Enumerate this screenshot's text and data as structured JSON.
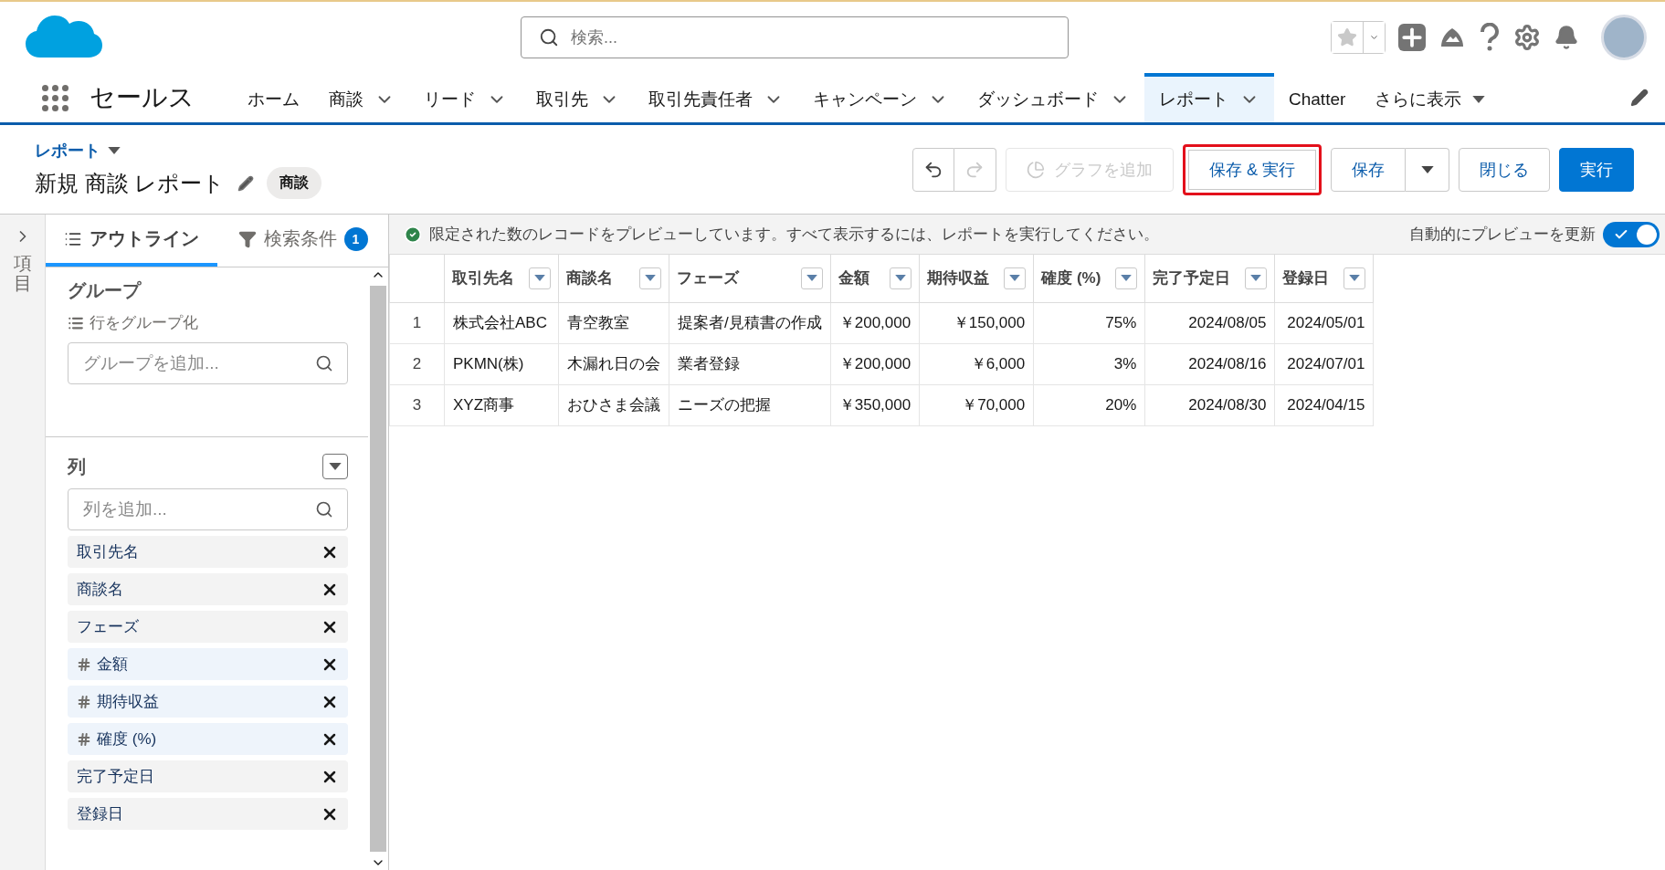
{
  "header": {
    "search_placeholder": "検索...",
    "favorite": false
  },
  "nav": {
    "app_name": "セールス",
    "items": [
      {
        "label": "ホーム",
        "kind": "plain",
        "selected": false
      },
      {
        "label": "商談",
        "kind": "menu",
        "selected": false
      },
      {
        "label": "リード",
        "kind": "menu",
        "selected": false
      },
      {
        "label": "取引先",
        "kind": "menu",
        "selected": false
      },
      {
        "label": "取引先責任者",
        "kind": "menu",
        "selected": false
      },
      {
        "label": "キャンペーン",
        "kind": "menu",
        "selected": false
      },
      {
        "label": "ダッシュボード",
        "kind": "menu",
        "selected": false
      },
      {
        "label": "レポート",
        "kind": "menu",
        "selected": true
      },
      {
        "label": "Chatter",
        "kind": "plain",
        "selected": false
      },
      {
        "label": "さらに表示",
        "kind": "more",
        "selected": false
      }
    ]
  },
  "page": {
    "breadcrumb": "レポート",
    "title": "新規 商談 レポート",
    "badge": "商談"
  },
  "history": {
    "undo_disabled": false,
    "redo_disabled": true
  },
  "buttons": [
    {
      "label": "グラフを追加",
      "kind": "chart",
      "disabled": true,
      "highlighted": false
    },
    {
      "label": "保存 & 実行",
      "kind": "outline",
      "disabled": false,
      "highlighted": true
    },
    {
      "label": "保存",
      "kind": "split",
      "disabled": false,
      "highlighted": false
    },
    {
      "label": "閉じる",
      "kind": "outline",
      "disabled": false,
      "highlighted": false
    },
    {
      "label": "実行",
      "kind": "brand",
      "disabled": false,
      "highlighted": false
    }
  ],
  "sidebar": {
    "strip_label": "項目",
    "tabs": [
      {
        "label": "アウトライン",
        "kind": "outline",
        "selected": true
      },
      {
        "label": "検索条件",
        "kind": "filter",
        "selected": false,
        "count": "1"
      }
    ],
    "groups": {
      "title": "グループ",
      "hint": "行をグループ化",
      "placeholder": "グループを追加..."
    },
    "columns": {
      "title": "列",
      "placeholder": "列を追加...",
      "items": [
        {
          "label": "取引先名",
          "kind": "text"
        },
        {
          "label": "商談名",
          "kind": "text"
        },
        {
          "label": "フェーズ",
          "kind": "text"
        },
        {
          "label": "金額",
          "kind": "number"
        },
        {
          "label": "期待収益",
          "kind": "number"
        },
        {
          "label": "確度 (%)",
          "kind": "number"
        },
        {
          "label": "完了予定日",
          "kind": "text"
        },
        {
          "label": "登録日",
          "kind": "text"
        }
      ]
    }
  },
  "preview": {
    "message": "限定された数のレコードをプレビューしています。すべて表示するには、レポートを実行してください。",
    "auto_update_label": "自動的にプレビューを更新",
    "auto_update_on": true
  },
  "table": {
    "columns": [
      {
        "label": "取引先名",
        "kind": "text"
      },
      {
        "label": "商談名",
        "kind": "text"
      },
      {
        "label": "フェーズ",
        "kind": "text"
      },
      {
        "label": "金額",
        "kind": "number"
      },
      {
        "label": "期待収益",
        "kind": "number"
      },
      {
        "label": "確度 (%)",
        "kind": "number"
      },
      {
        "label": "完了予定日",
        "kind": "number"
      },
      {
        "label": "登録日",
        "kind": "number"
      }
    ],
    "rows": [
      {
        "number": "1",
        "cells": [
          "株式会社ABC",
          "青空教室",
          "提案者/見積書の作成",
          "￥200,000",
          "￥150,000",
          "75%",
          "2024/08/05",
          "2024/05/01"
        ]
      },
      {
        "number": "2",
        "cells": [
          "PKMN(株)",
          "木漏れ日の会",
          "業者登録",
          "￥200,000",
          "￥6,000",
          "3%",
          "2024/08/16",
          "2024/07/01"
        ]
      },
      {
        "number": "3",
        "cells": [
          "XYZ商事",
          "おひさま会議",
          "ニーズの把握",
          "￥350,000",
          "￥70,000",
          "20%",
          "2024/08/30",
          "2024/04/15"
        ]
      }
    ]
  }
}
